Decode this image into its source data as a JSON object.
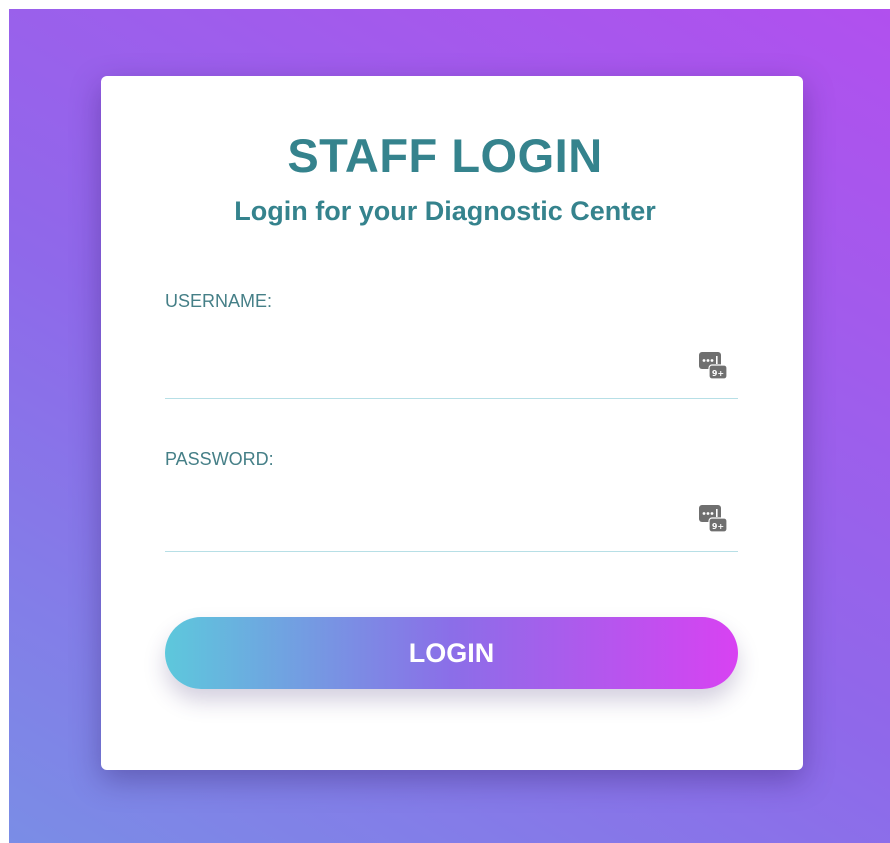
{
  "login": {
    "title": "STAFF LOGIN",
    "subtitle": "Login for your Diagnostic Center",
    "username": {
      "label": "USERNAME:",
      "value": "",
      "placeholder": ""
    },
    "password": {
      "label": "PASSWORD:",
      "value": "",
      "placeholder": ""
    },
    "submit_label": "LOGIN"
  },
  "icons": {
    "field_icon": "password-manager-key-icon"
  },
  "colors": {
    "heading": "#35838d",
    "label": "#457f87",
    "background_start": "#7a8de6",
    "background_end": "#b150ee",
    "button_start": "#5dc8dc",
    "button_end": "#d842f2"
  }
}
